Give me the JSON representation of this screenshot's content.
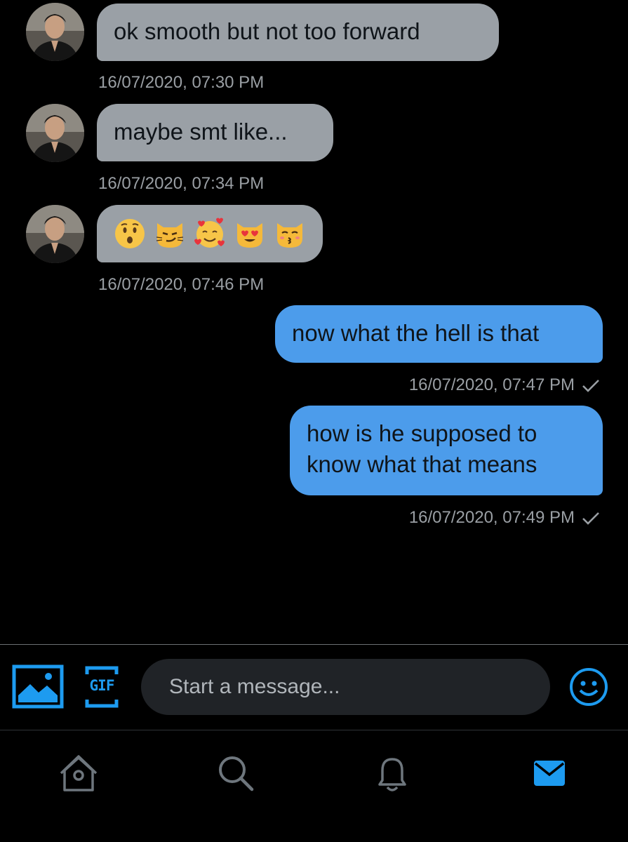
{
  "messages": [
    {
      "direction": "in",
      "text": "ok smooth but not too forward",
      "timestamp": "16/07/2020, 07:30 PM"
    },
    {
      "direction": "in",
      "text": "maybe smt like...",
      "timestamp": "16/07/2020, 07:34 PM"
    },
    {
      "direction": "in",
      "emojis": [
        "hushed-face",
        "smirking-cat-face",
        "smiling-face-with-hearts",
        "heart-eyes-cat-face",
        "kissing-cat-face"
      ],
      "timestamp": "16/07/2020, 07:46 PM"
    },
    {
      "direction": "out",
      "text": "now what the hell is that",
      "timestamp": "16/07/2020, 07:47 PM",
      "status": "sent-check"
    },
    {
      "direction": "out",
      "text_lines": [
        "how is he supposed to",
        "know what that means"
      ],
      "timestamp": "16/07/2020, 07:49 PM",
      "status": "sent-check"
    }
  ],
  "composer": {
    "placeholder": "Start a message...",
    "media_icon": "image-icon",
    "gif_label": "GIF",
    "emoji_icon": "emoji-icon"
  },
  "tabbar": {
    "items": [
      {
        "icon": "home-icon",
        "active": false
      },
      {
        "icon": "search-icon",
        "active": false
      },
      {
        "icon": "notifications-icon",
        "active": false
      },
      {
        "icon": "messages-icon",
        "active": true
      }
    ]
  },
  "colors": {
    "background": "#000000",
    "incoming_bubble": "#9aa0a6",
    "outgoing_bubble": "#4c9ceb",
    "accent": "#1d9bf0",
    "timestamp": "#9a9fa4"
  }
}
